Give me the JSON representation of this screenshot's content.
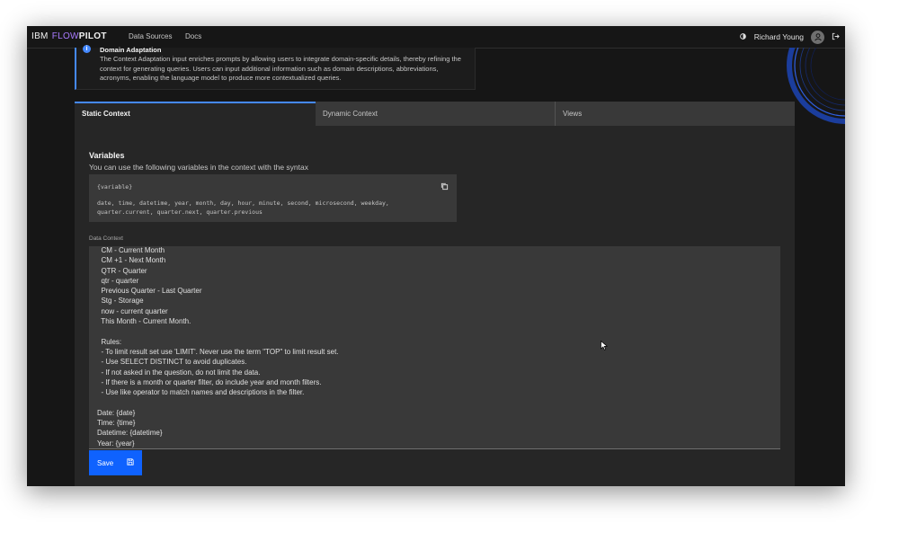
{
  "header": {
    "brand_ibm": "IBM",
    "brand_flow": "FLOW",
    "brand_pilot": "PILOT",
    "nav": [
      "Data Sources",
      "Docs"
    ],
    "user_name": "Richard Young",
    "icons": [
      "theme-toggle-icon",
      "user-avatar-icon",
      "logout-icon"
    ]
  },
  "info": {
    "title": "Domain Adaptation",
    "body": "The Context Adaptation input enriches prompts by allowing users to integrate domain-specific details, thereby refining the context for generating queries. Users can input additional information such as domain descriptions, abbreviations, acronyms, enabling the language model to produce more contextualized queries."
  },
  "tabs": [
    "Static Context",
    "Dynamic Context",
    "Views"
  ],
  "active_tab": "Static Context",
  "variables": {
    "title": "Variables",
    "description": "You can use the following variables in the context with the syntax",
    "syntax": "{variable}",
    "list": "date, time, datetime, year, month, day, hour, minute, second, microsecond, weekday, quarter.current, quarter.next, quarter.previous"
  },
  "data_context": {
    "label": "Data Context",
    "lines": [
      "  CM - Current Month",
      "  CM +1 - Next Month",
      "  QTR - Quarter",
      "  qtr - quarter",
      "  Previous Quarter - Last Quarter",
      "  Stg - Storage",
      "  now - current quarter",
      "  This Month - Current Month.",
      "",
      "  Rules:",
      "  - To limit result set use 'LIMIT'. Never use the term \"TOP\" to limit result set.",
      "  - Use SELECT DISTINCT to avoid duplicates.",
      "  - If not asked in the question, do not limit the data.",
      "  - If there is a month or quarter filter, do include year and month filters.",
      "  - Use like operator to match names and descriptions in the filter.",
      "",
      "Date: {date}",
      "Time: {time}",
      "Datetime: {datetime}",
      "Year: {year}"
    ]
  },
  "save_label": "Save",
  "colors": {
    "accent": "#0f62fe",
    "brand_flow": "#a97bff",
    "background": "#161616",
    "panel": "#262626"
  }
}
